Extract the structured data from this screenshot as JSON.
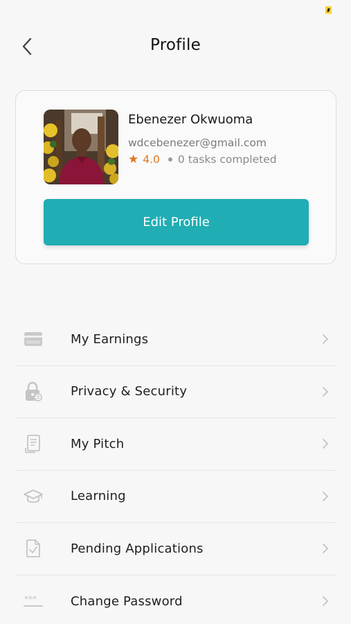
{
  "header": {
    "title": "Profile",
    "back_icon": "chevron-left-icon"
  },
  "profile": {
    "name": "Ebenezer Okwuoma",
    "email": "wdcebenezer@gmail.com",
    "rating": "4.0",
    "tasks_completed": "0 tasks completed",
    "edit_button_label": "Edit Profile"
  },
  "menu": {
    "items": [
      {
        "label": "My Earnings",
        "icon": "card-icon"
      },
      {
        "label": "Privacy & Security",
        "icon": "lock-icon"
      },
      {
        "label": "My Pitch",
        "icon": "document-icon"
      },
      {
        "label": "Learning",
        "icon": "graduation-cap-icon"
      },
      {
        "label": "Pending Applications",
        "icon": "file-check-icon"
      },
      {
        "label": "Change Password",
        "icon": "password-icon"
      }
    ]
  },
  "colors": {
    "accent": "#20adb4",
    "rating": "#e0761c",
    "background": "#f7f7f7",
    "icon_gray": "#c4c4c4",
    "battery": "#f4d03f"
  }
}
